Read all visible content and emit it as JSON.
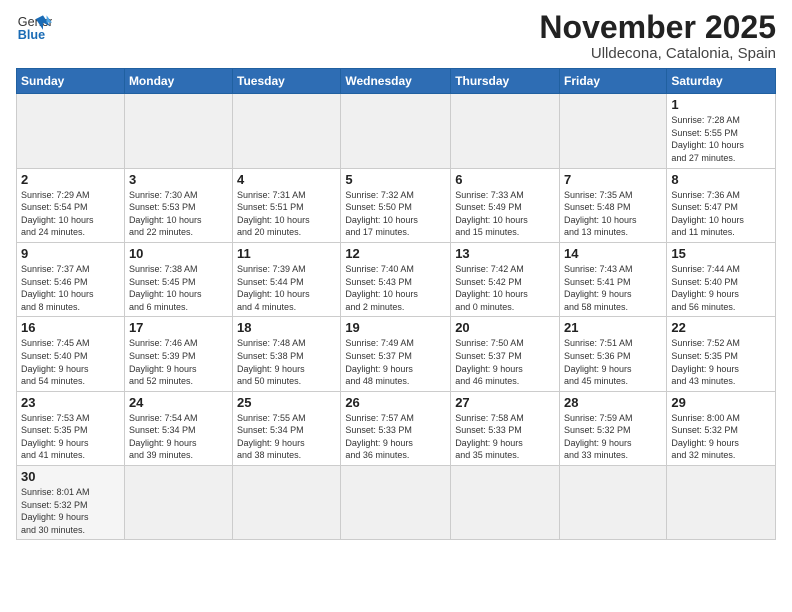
{
  "logo": {
    "line1": "General",
    "line2": "Blue"
  },
  "title": "November 2025",
  "subtitle": "Ulldecona, Catalonia, Spain",
  "days_of_week": [
    "Sunday",
    "Monday",
    "Tuesday",
    "Wednesday",
    "Thursday",
    "Friday",
    "Saturday"
  ],
  "weeks": [
    [
      {
        "day": "",
        "info": ""
      },
      {
        "day": "",
        "info": ""
      },
      {
        "day": "",
        "info": ""
      },
      {
        "day": "",
        "info": ""
      },
      {
        "day": "",
        "info": ""
      },
      {
        "day": "",
        "info": ""
      },
      {
        "day": "1",
        "info": "Sunrise: 7:28 AM\nSunset: 5:55 PM\nDaylight: 10 hours\nand 27 minutes."
      }
    ],
    [
      {
        "day": "2",
        "info": "Sunrise: 7:29 AM\nSunset: 5:54 PM\nDaylight: 10 hours\nand 24 minutes."
      },
      {
        "day": "3",
        "info": "Sunrise: 7:30 AM\nSunset: 5:53 PM\nDaylight: 10 hours\nand 22 minutes."
      },
      {
        "day": "4",
        "info": "Sunrise: 7:31 AM\nSunset: 5:51 PM\nDaylight: 10 hours\nand 20 minutes."
      },
      {
        "day": "5",
        "info": "Sunrise: 7:32 AM\nSunset: 5:50 PM\nDaylight: 10 hours\nand 17 minutes."
      },
      {
        "day": "6",
        "info": "Sunrise: 7:33 AM\nSunset: 5:49 PM\nDaylight: 10 hours\nand 15 minutes."
      },
      {
        "day": "7",
        "info": "Sunrise: 7:35 AM\nSunset: 5:48 PM\nDaylight: 10 hours\nand 13 minutes."
      },
      {
        "day": "8",
        "info": "Sunrise: 7:36 AM\nSunset: 5:47 PM\nDaylight: 10 hours\nand 11 minutes."
      }
    ],
    [
      {
        "day": "9",
        "info": "Sunrise: 7:37 AM\nSunset: 5:46 PM\nDaylight: 10 hours\nand 8 minutes."
      },
      {
        "day": "10",
        "info": "Sunrise: 7:38 AM\nSunset: 5:45 PM\nDaylight: 10 hours\nand 6 minutes."
      },
      {
        "day": "11",
        "info": "Sunrise: 7:39 AM\nSunset: 5:44 PM\nDaylight: 10 hours\nand 4 minutes."
      },
      {
        "day": "12",
        "info": "Sunrise: 7:40 AM\nSunset: 5:43 PM\nDaylight: 10 hours\nand 2 minutes."
      },
      {
        "day": "13",
        "info": "Sunrise: 7:42 AM\nSunset: 5:42 PM\nDaylight: 10 hours\nand 0 minutes."
      },
      {
        "day": "14",
        "info": "Sunrise: 7:43 AM\nSunset: 5:41 PM\nDaylight: 9 hours\nand 58 minutes."
      },
      {
        "day": "15",
        "info": "Sunrise: 7:44 AM\nSunset: 5:40 PM\nDaylight: 9 hours\nand 56 minutes."
      }
    ],
    [
      {
        "day": "16",
        "info": "Sunrise: 7:45 AM\nSunset: 5:40 PM\nDaylight: 9 hours\nand 54 minutes."
      },
      {
        "day": "17",
        "info": "Sunrise: 7:46 AM\nSunset: 5:39 PM\nDaylight: 9 hours\nand 52 minutes."
      },
      {
        "day": "18",
        "info": "Sunrise: 7:48 AM\nSunset: 5:38 PM\nDaylight: 9 hours\nand 50 minutes."
      },
      {
        "day": "19",
        "info": "Sunrise: 7:49 AM\nSunset: 5:37 PM\nDaylight: 9 hours\nand 48 minutes."
      },
      {
        "day": "20",
        "info": "Sunrise: 7:50 AM\nSunset: 5:37 PM\nDaylight: 9 hours\nand 46 minutes."
      },
      {
        "day": "21",
        "info": "Sunrise: 7:51 AM\nSunset: 5:36 PM\nDaylight: 9 hours\nand 45 minutes."
      },
      {
        "day": "22",
        "info": "Sunrise: 7:52 AM\nSunset: 5:35 PM\nDaylight: 9 hours\nand 43 minutes."
      }
    ],
    [
      {
        "day": "23",
        "info": "Sunrise: 7:53 AM\nSunset: 5:35 PM\nDaylight: 9 hours\nand 41 minutes."
      },
      {
        "day": "24",
        "info": "Sunrise: 7:54 AM\nSunset: 5:34 PM\nDaylight: 9 hours\nand 39 minutes."
      },
      {
        "day": "25",
        "info": "Sunrise: 7:55 AM\nSunset: 5:34 PM\nDaylight: 9 hours\nand 38 minutes."
      },
      {
        "day": "26",
        "info": "Sunrise: 7:57 AM\nSunset: 5:33 PM\nDaylight: 9 hours\nand 36 minutes."
      },
      {
        "day": "27",
        "info": "Sunrise: 7:58 AM\nSunset: 5:33 PM\nDaylight: 9 hours\nand 35 minutes."
      },
      {
        "day": "28",
        "info": "Sunrise: 7:59 AM\nSunset: 5:32 PM\nDaylight: 9 hours\nand 33 minutes."
      },
      {
        "day": "29",
        "info": "Sunrise: 8:00 AM\nSunset: 5:32 PM\nDaylight: 9 hours\nand 32 minutes."
      }
    ],
    [
      {
        "day": "30",
        "info": "Sunrise: 8:01 AM\nSunset: 5:32 PM\nDaylight: 9 hours\nand 30 minutes."
      },
      {
        "day": "",
        "info": ""
      },
      {
        "day": "",
        "info": ""
      },
      {
        "day": "",
        "info": ""
      },
      {
        "day": "",
        "info": ""
      },
      {
        "day": "",
        "info": ""
      },
      {
        "day": "",
        "info": ""
      }
    ]
  ]
}
